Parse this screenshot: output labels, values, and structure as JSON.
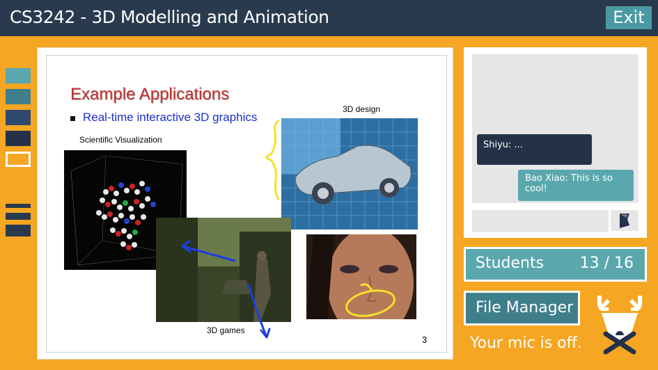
{
  "header": {
    "title": "CS3242 - 3D Modelling and Animation",
    "exit_label": "Exit"
  },
  "palette": {
    "colors": [
      "#5aa8ae",
      "#3e7f8b",
      "#2d4a6e",
      "#23324a",
      "transparent"
    ],
    "selected_index": 4,
    "icon": "hamburger-menu-icon"
  },
  "slide": {
    "heading": "Example Applications",
    "bullet": "Real-time interactive 3D graphics",
    "labels": {
      "scientific": "Scientific Visualization",
      "design": "3D design",
      "games": "3D games"
    },
    "page_number": "3",
    "annotations": {
      "colors": [
        "#f5e12a",
        "#1a3fe0"
      ]
    }
  },
  "chat": {
    "messages": [
      {
        "author": "Shiyu",
        "text": "Shiyu: ..."
      },
      {
        "author": "Bao Xiao",
        "text": "Bao Xiao: This is so cool!"
      }
    ],
    "input_placeholder": "",
    "send_icon": "send-icon"
  },
  "students": {
    "label": "Students",
    "count": "13 / 16"
  },
  "file_manager": {
    "label": "File Manager"
  },
  "mic": {
    "status": "Your mic is off.",
    "icon": "deer-mascot-mic-muted-icon"
  },
  "colors": {
    "accent": "#f5a623",
    "header": "#2a3a4e",
    "teal": "#5aa8ae",
    "teal_dark": "#3e7f8b"
  }
}
